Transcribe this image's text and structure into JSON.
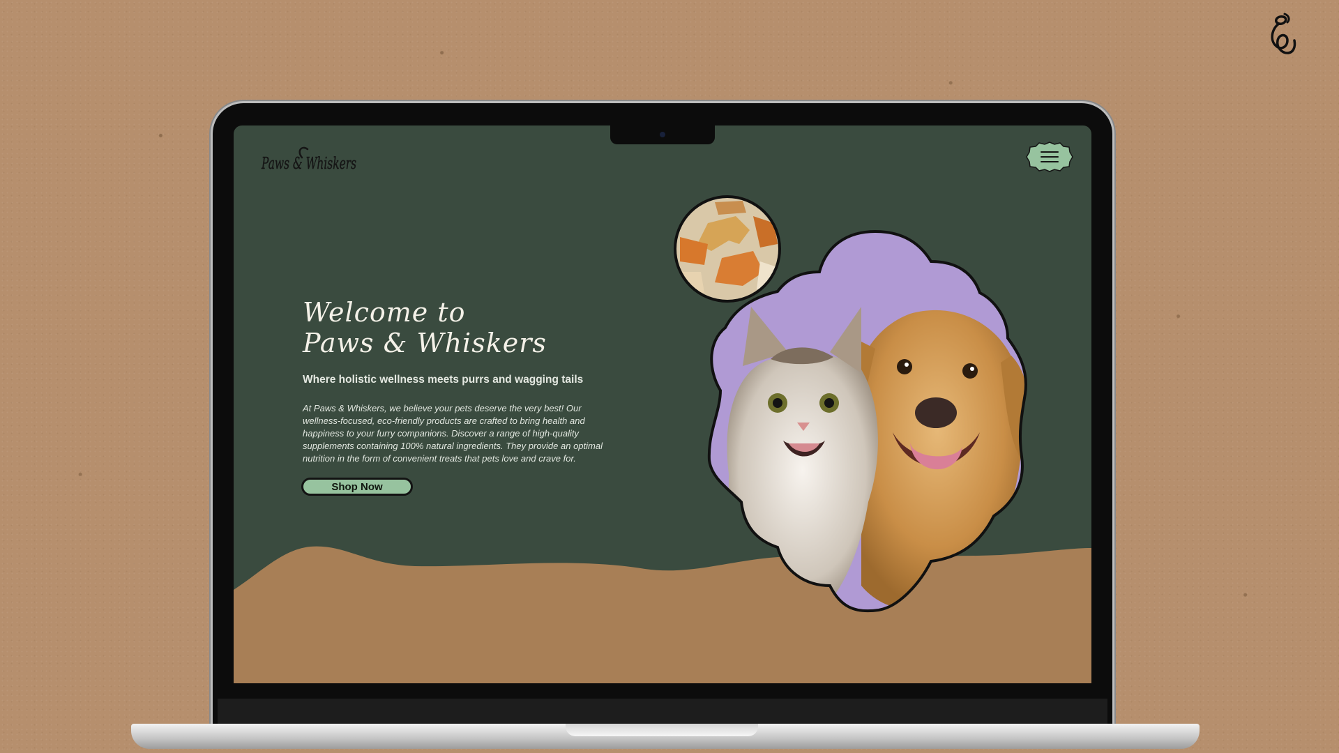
{
  "site": {
    "brand": "Paws & Whiskers",
    "nav": {
      "menu_icon": "hamburger-menu-icon"
    }
  },
  "hero": {
    "title_line1": "Welcome to",
    "title_line2": "Paws & Whiskers",
    "subtitle": "Where holistic wellness meets purrs and wagging tails",
    "body": "At Paws & Whiskers, we believe your pets deserve the very best! Our wellness-focused, eco-friendly products are crafted to bring health and happiness to your furry companions. Discover a range of high-quality supplements containing 100% natural ingredients. They provide an optimal nutrition in the form of convenient treats that pets love and crave for.",
    "cta_label": "Shop Now"
  },
  "colors": {
    "page_background": "#3a4b3f",
    "ground": "#a87f56",
    "accent": "#97c39f",
    "blob": "#b09ad4",
    "backdrop": "#b68f6d"
  },
  "images": {
    "treats": "bone-shaped-pet-treats-photo",
    "pets": "cat-and-golden-retriever-photo"
  }
}
